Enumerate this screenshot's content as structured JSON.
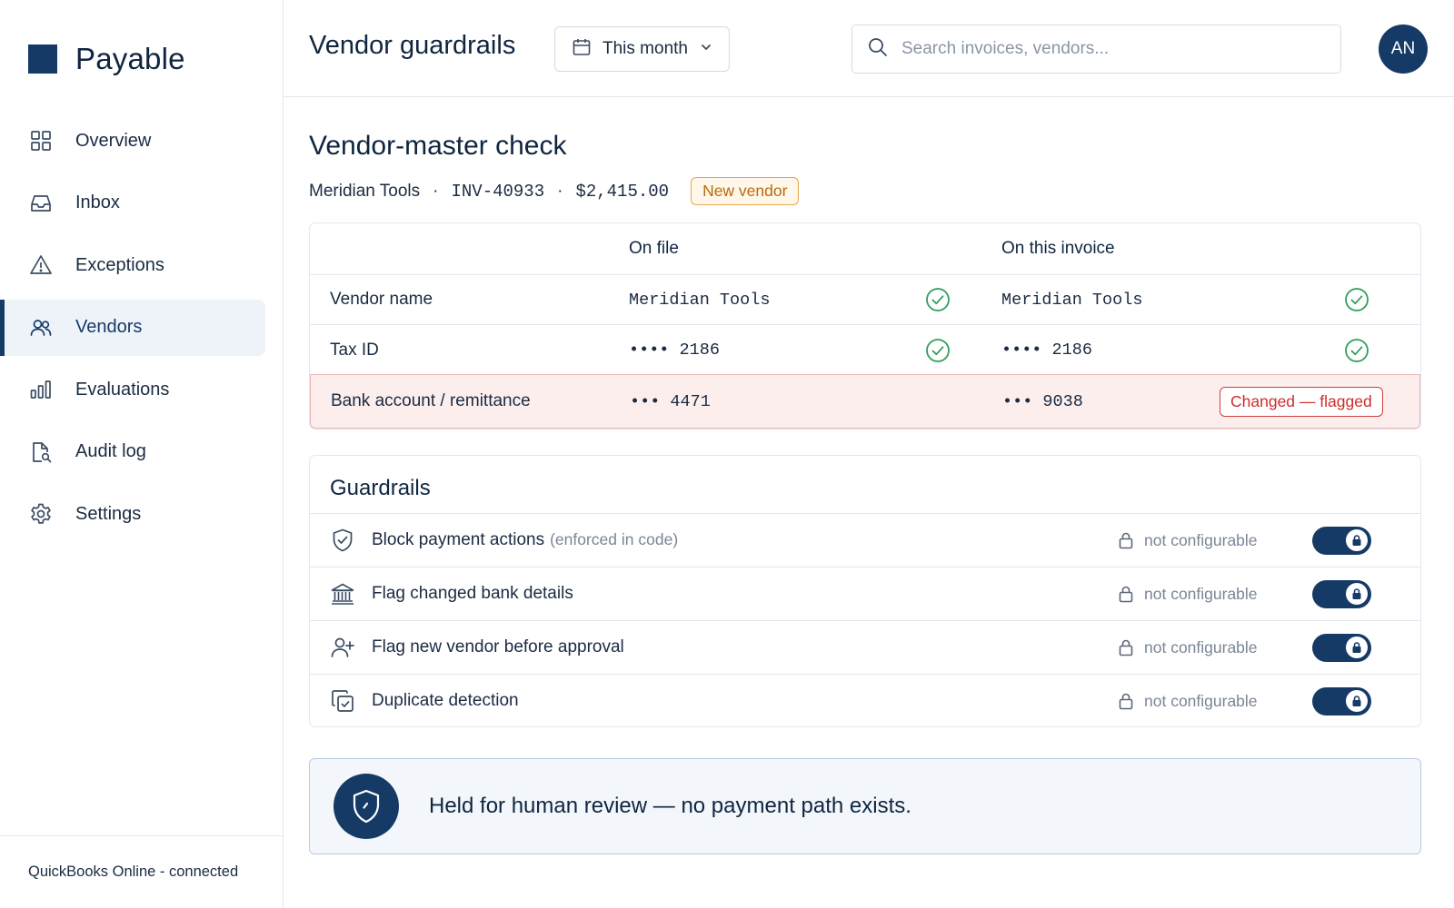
{
  "app": {
    "name": "Payable"
  },
  "sidebar": {
    "items": [
      {
        "label": "Overview",
        "icon": "grid-icon"
      },
      {
        "label": "Inbox",
        "icon": "inbox-icon"
      },
      {
        "label": "Exceptions",
        "icon": "warning-icon"
      },
      {
        "label": "Vendors",
        "icon": "users-icon",
        "active": true
      },
      {
        "label": "Evaluations",
        "icon": "bar-chart-icon"
      },
      {
        "label": "Audit log",
        "icon": "file-search-icon"
      },
      {
        "label": "Settings",
        "icon": "gear-icon"
      }
    ],
    "footer": "QuickBooks Online - connected"
  },
  "header": {
    "title": "Vendor guardrails",
    "period": "This month",
    "search_placeholder": "Search invoices, vendors...",
    "avatar_initials": "AN"
  },
  "check": {
    "title": "Vendor-master check",
    "vendor": "Meridian Tools",
    "invoice_id": "INV-40933",
    "amount": "$2,415.00",
    "badge": "New vendor",
    "separator": "·",
    "columns": {
      "on_file": "On file",
      "on_invoice": "On this invoice"
    },
    "rows": [
      {
        "label": "Vendor name",
        "on_file": "Meridian Tools",
        "on_invoice": "Meridian Tools",
        "status": "match"
      },
      {
        "label": "Tax ID",
        "on_file": "•••• 2186",
        "on_invoice": "•••• 2186",
        "status": "match"
      },
      {
        "label": "Bank account / remittance",
        "on_file": "••• 4471",
        "on_invoice": "••• 9038",
        "status": "Changed — flagged"
      }
    ]
  },
  "guardrails": {
    "title": "Guardrails",
    "items": [
      {
        "label": "Block payment actions",
        "note": "(enforced in code)",
        "icon": "shield-check-icon",
        "status": "not configurable",
        "enabled": true
      },
      {
        "label": "Flag changed bank details",
        "note": "",
        "icon": "bank-icon",
        "status": "not configurable",
        "enabled": true
      },
      {
        "label": "Flag new vendor before approval",
        "note": "",
        "icon": "user-plus-icon",
        "status": "not configurable",
        "enabled": true
      },
      {
        "label": "Duplicate detection",
        "note": "",
        "icon": "copy-icon",
        "status": "not configurable",
        "enabled": true
      }
    ]
  },
  "banner": {
    "text": "Held for human review — no payment path exists."
  },
  "colors": {
    "brand": "#163a66",
    "flag_red": "#d12b2b",
    "flag_bg": "#fdeeee",
    "ok_green": "#2f9e5a",
    "new_badge": "#e8a64a"
  }
}
